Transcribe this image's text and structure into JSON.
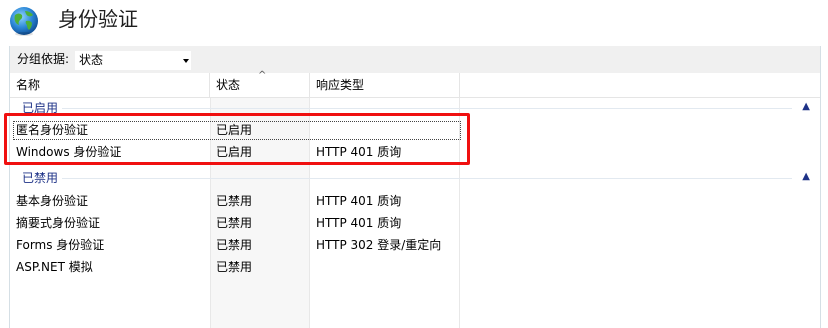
{
  "page": {
    "title": "身份验证",
    "icon": "globe-icon"
  },
  "toolbar": {
    "group_by_label": "分组依据:",
    "group_by_value": "状态"
  },
  "columns": {
    "name": "名称",
    "status": "状态",
    "response_type": "响应类型"
  },
  "groups": [
    {
      "label": "已启用",
      "rows": [
        {
          "name": "匿名身份验证",
          "status": "已启用",
          "response": ""
        },
        {
          "name": "Windows 身份验证",
          "status": "已启用",
          "response": "HTTP 401 质询"
        }
      ]
    },
    {
      "label": "已禁用",
      "rows": [
        {
          "name": "基本身份验证",
          "status": "已禁用",
          "response": "HTTP 401 质询"
        },
        {
          "name": "摘要式身份验证",
          "status": "已禁用",
          "response": "HTTP 401 质询"
        },
        {
          "name": "Forms 身份验证",
          "status": "已禁用",
          "response": "HTTP 302 登录/重定向"
        },
        {
          "name": "ASP.NET 模拟",
          "status": "已禁用",
          "response": ""
        }
      ]
    }
  ],
  "colors": {
    "highlight": "#f01010",
    "group_text": "#1e3287"
  }
}
